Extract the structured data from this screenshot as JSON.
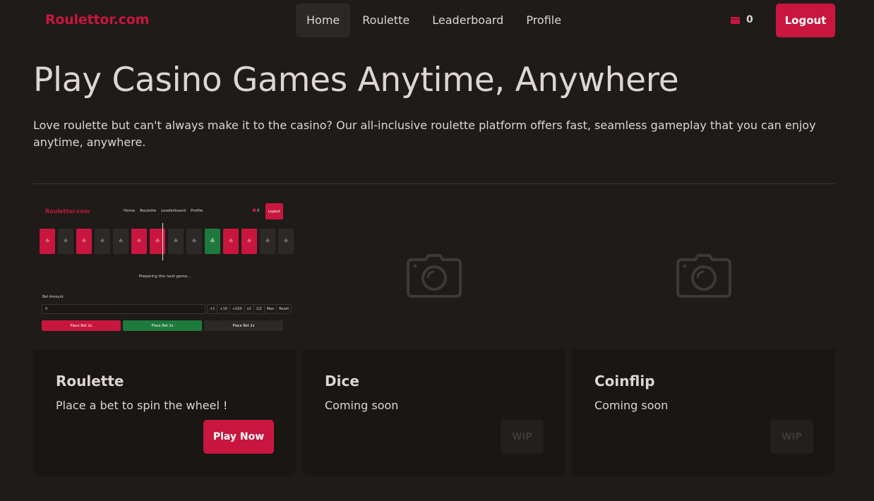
{
  "nav": {
    "brand": "Roulettor.com",
    "links": [
      {
        "label": "Home",
        "active": true
      },
      {
        "label": "Roulette",
        "active": false
      },
      {
        "label": "Leaderboard",
        "active": false
      },
      {
        "label": "Profile",
        "active": false
      }
    ],
    "balance": "0",
    "logout_label": "Logout",
    "wallet_icon": "wallet-icon"
  },
  "hero": {
    "title": "Play Casino Games Anytime, Anywhere",
    "description": "Love roulette but can't always make it to the casino? Our all-inclusive roulette platform offers fast, seamless gameplay that you can enjoy anytime, anywhere."
  },
  "games": [
    {
      "title": "Roulette",
      "description": "Place a bet to spin the wheel !",
      "button": "Play Now",
      "image": "preview"
    },
    {
      "title": "Dice",
      "description": "Coming soon",
      "button": "WIP",
      "image": "camera-icon"
    },
    {
      "title": "Coinflip",
      "description": "Coming soon",
      "button": "WIP",
      "image": "camera-icon"
    }
  ],
  "preview": {
    "brand": "Roulettor.com",
    "nav": [
      "Home",
      "Roulette",
      "Leaderboard",
      "Profile"
    ],
    "balance": "0",
    "logout": "Logout",
    "tiles": [
      "red",
      "black",
      "red",
      "black",
      "black",
      "red",
      "red",
      "black",
      "black",
      "green",
      "red",
      "red",
      "black",
      "black"
    ],
    "status": "Preparing the next game...",
    "bet_label": "Bet Amount",
    "bet_value": "0",
    "quick": [
      "+1",
      "+10",
      "+100",
      "x2",
      "1/2",
      "Max",
      "Reset"
    ],
    "bets": [
      {
        "label": "Place Bet 2x",
        "color": "red"
      },
      {
        "label": "Place Bet 2x",
        "color": "green"
      },
      {
        "label": "Place Bet 2x",
        "color": "black"
      }
    ]
  },
  "colors": {
    "accent": "#c8163f",
    "background": "#1f1b19",
    "card": "#191614",
    "green": "#1d7a3c"
  }
}
